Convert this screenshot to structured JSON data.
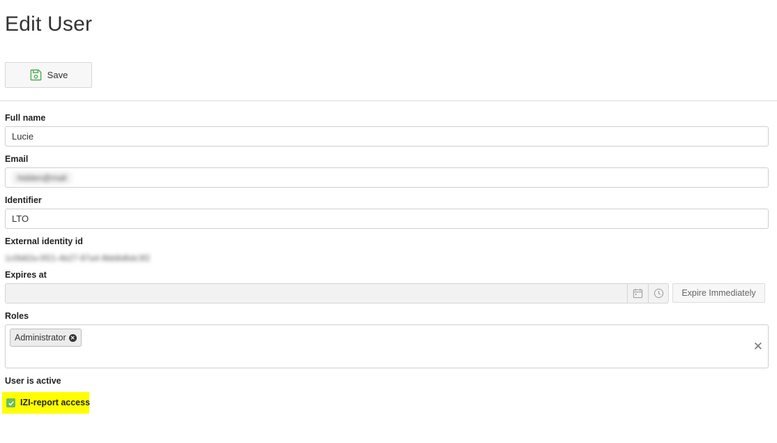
{
  "page": {
    "title": "Edit User"
  },
  "toolbar": {
    "save_label": "Save",
    "save_icon": "floppy-disk-icon",
    "accent": "#4caf50"
  },
  "form": {
    "full_name": {
      "label": "Full name",
      "value": "Lucie"
    },
    "email": {
      "label": "Email",
      "value": "hidden@mail"
    },
    "identifier": {
      "label": "Identifier",
      "value": "LTO"
    },
    "external_identity": {
      "label": "External identity id",
      "value": "1c0b82a-0f21-4b27-97a4-9bb8d6dc3f2"
    },
    "expires_at": {
      "label": "Expires at",
      "value": "",
      "calendar_icon": "calendar-icon",
      "clock_icon": "clock-icon",
      "expire_button": "Expire Immediately"
    },
    "roles": {
      "label": "Roles",
      "items": [
        "Administrator"
      ],
      "clear_icon": "clear-x-icon"
    },
    "user_is_active": {
      "label": "User is active"
    },
    "izi_report": {
      "label": "IZI-report access",
      "checked": true,
      "highlight_color": "#ffff00"
    }
  }
}
